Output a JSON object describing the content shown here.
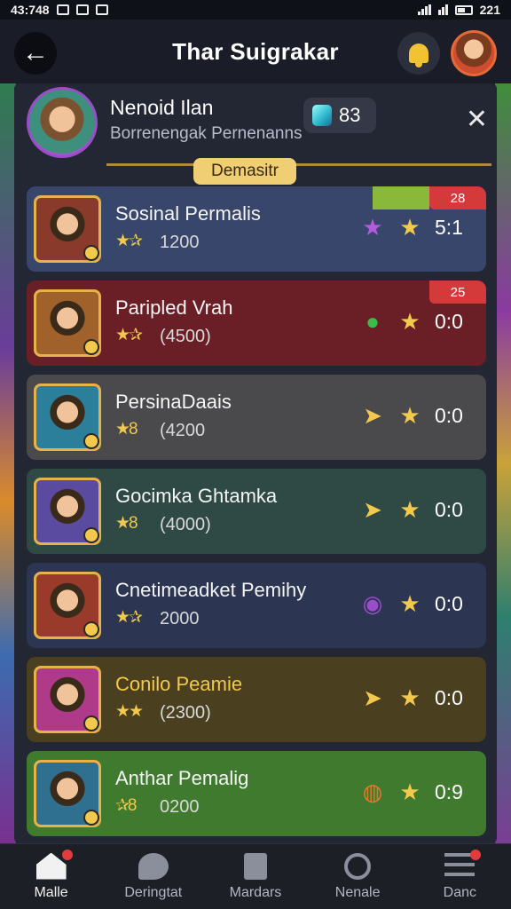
{
  "status_bar": {
    "time": "43:748",
    "right_time": "221"
  },
  "header": {
    "title": "Thar Suigrakar"
  },
  "profile": {
    "name": "Nenoid Ilan",
    "subtitle": "Borrenengak Pernenanns",
    "gem_count": "83"
  },
  "section_tag": "Demasitr",
  "rows": [
    {
      "name": "Sosinal Permalis",
      "stars": "★✰",
      "points": "1200",
      "score": "5:1",
      "bar_label": "28",
      "bg": "#37466a",
      "thumb_bg": "#8a3a2b",
      "icon_a": "★",
      "icon_a_color": "#b45bdc",
      "name_color": "#f5f5f5"
    },
    {
      "name": "Paripled Vrah",
      "stars": "★✰",
      "points": "(4500)",
      "score": "0:0",
      "bar_label": "25",
      "bg": "#6a1f27",
      "thumb_bg": "#a0622a",
      "icon_a": "●",
      "icon_a_color": "#3cba4a",
      "name_color": "#f5f5f5"
    },
    {
      "name": "PersinaDaais",
      "stars": "★8",
      "points": "(4200",
      "score": "0:0",
      "bg": "#4a4a4c",
      "thumb_bg": "#2c7f9a",
      "icon_a": "➤",
      "icon_a_color": "#f2c94c",
      "name_color": "#f5f5f5"
    },
    {
      "name": "Gocimka Ghtamka",
      "stars": "★8",
      "points": "(4000)",
      "score": "0:0",
      "bg": "#2f4a45",
      "thumb_bg": "#5a4aa0",
      "icon_a": "➤",
      "icon_a_color": "#f2c94c",
      "name_color": "#f5f5f5"
    },
    {
      "name": "Cnetimeadket Pemihy",
      "stars": "★✰",
      "points": "2000",
      "score": "0:0",
      "bg": "#2c3552",
      "thumb_bg": "#9a3a2a",
      "icon_a": "◉",
      "icon_a_color": "#9b4cc9",
      "name_color": "#f5f5f5"
    },
    {
      "name": "Conilo Peamie",
      "stars": "★★",
      "points": "(2300)",
      "score": "0:0",
      "bg": "#4a3f1f",
      "thumb_bg": "#b03a8a",
      "icon_a": "➤",
      "icon_a_color": "#f2c94c",
      "name_color": "#f2c94c"
    },
    {
      "name": "Anthar Pemalig",
      "stars": "✰8",
      "points": "0200",
      "score": "0:9",
      "bg": "#3f7a2e",
      "thumb_bg": "#2f6f8f",
      "icon_a": "◍",
      "icon_a_color": "#e07b2a",
      "name_color": "#f5f5f5"
    }
  ],
  "nav": [
    {
      "label": "Malle",
      "icon": "home-icon",
      "active": true,
      "dot": true
    },
    {
      "label": "Deringtat",
      "icon": "chat-icon",
      "active": false,
      "dot": false
    },
    {
      "label": "Mardars",
      "icon": "doc-icon",
      "active": false,
      "dot": false
    },
    {
      "label": "Nenale",
      "icon": "search-icon",
      "active": false,
      "dot": false
    },
    {
      "label": "Danc",
      "icon": "menu-icon",
      "active": false,
      "dot": true
    }
  ]
}
